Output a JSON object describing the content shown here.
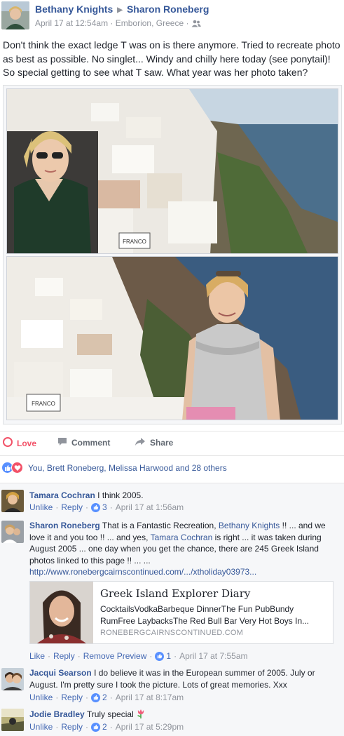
{
  "post": {
    "author": "Bethany Knights",
    "target": "Sharon Roneberg",
    "timestamp": "April 17 at 12:54am",
    "location": "Emborion, Greece",
    "privacy_icon": "friends-icon",
    "text": "Don't think the exact ledge T was on is there anymore. Tried to recreate photo as best as possible. No singlet... Windy and chilly here today (see ponytail)! So special getting to see what T saw. What year was her photo taken?"
  },
  "actions": {
    "love": "Love",
    "comment": "Comment",
    "share": "Share"
  },
  "reactions": {
    "summary": "You, Brett Roneberg, Melissa Harwood and 28 others",
    "icons": [
      "like-icon",
      "love-icon"
    ]
  },
  "photos": {
    "top_sign": "FRANCO",
    "bottom_sign": "FRANCO"
  },
  "comments": [
    {
      "name": "Tamara Cochran",
      "text": "I think 2005.",
      "unlike": "Unlike",
      "reply": "Reply",
      "likes": "3",
      "time": "April 17 at 1:56am"
    },
    {
      "name": "Sharon Roneberg",
      "text_a": "That is a Fantastic Recreation,",
      "mention_1": "Bethany Knights",
      "text_b": "!! ... and we love it and you too !! ... and yes,",
      "mention_2": "Tamara Cochran",
      "text_c": "is right ... it was taken during August 2005 ... one day when you get the chance, there are 245 Greek Island photos linked to this page !! ... ...",
      "url": "http://www.ronebergcairnscontinued.com/.../xtholiday03973...",
      "preview_title": "Greek Island Explorer Diary",
      "preview_desc": "CocktailsVodkaBarbeque DinnerThe Fun PubBundy RumFree LaybacksThe Red Bull Bar Very Hot Boys In...",
      "preview_domain": "RONEBERGCAIRNSCONTINUED.COM",
      "like": "Like",
      "reply": "Reply",
      "remove_preview": "Remove Preview",
      "likes": "1",
      "time": "April 17 at 7:55am"
    },
    {
      "name": "Jacqui Searson",
      "text": "I do believe it was in the European summer of 2005. July or August. I'm pretty sure I took the picture. Lots of great memories. Xxx",
      "unlike": "Unlike",
      "reply": "Reply",
      "likes": "2",
      "time": "April 17 at 8:17am"
    },
    {
      "name": "Jodie Bradley",
      "text": "Truly special",
      "emoji": "tulip-icon",
      "unlike": "Unlike",
      "reply": "Reply",
      "likes": "2",
      "time": "April 17 at 5:29pm"
    }
  ],
  "colors": {
    "link": "#365899",
    "love": "#f25268",
    "like": "#5890ff",
    "meta": "#90949c"
  }
}
